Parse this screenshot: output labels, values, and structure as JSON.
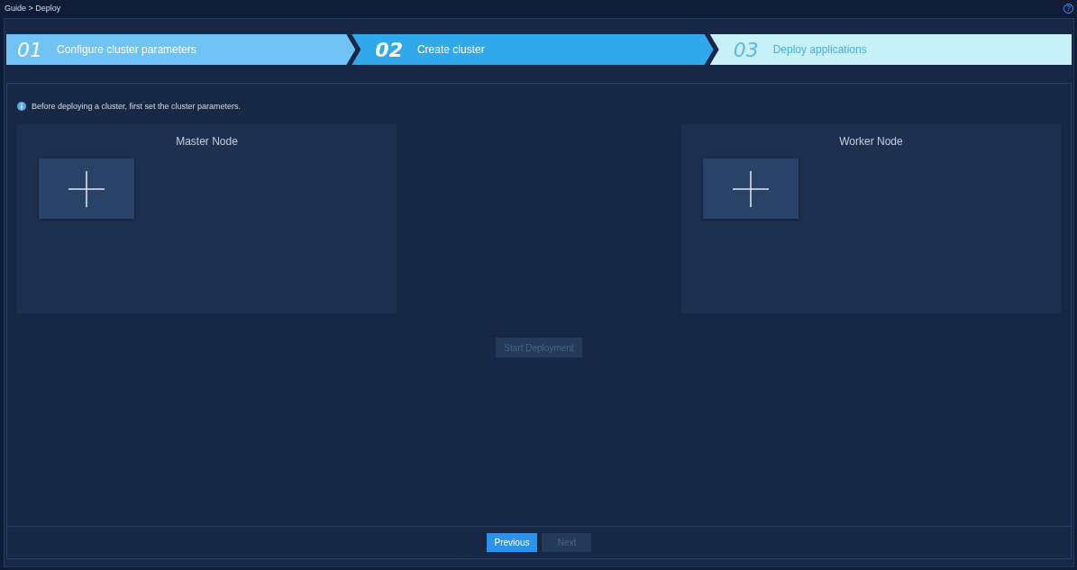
{
  "breadcrumb": "Guide > Deploy",
  "help": "?",
  "steps": [
    {
      "number": "01",
      "label": "Configure cluster parameters",
      "completed": true,
      "selected": false
    },
    {
      "number": "02",
      "label": "Create cluster",
      "completed": false,
      "selected": true
    },
    {
      "number": "03",
      "label": "Deploy applications",
      "completed": false,
      "selected": false
    }
  ],
  "info": "Before deploying a cluster, first set the cluster parameters.",
  "nodes": [
    {
      "title": "Master Node"
    },
    {
      "title": "Worker Node"
    }
  ],
  "start_button": {
    "label": "Start Deployment",
    "disabled": true
  },
  "footer_buttons": [
    {
      "label": "Previous",
      "disabled": false
    },
    {
      "label": "Next",
      "disabled": true
    }
  ]
}
